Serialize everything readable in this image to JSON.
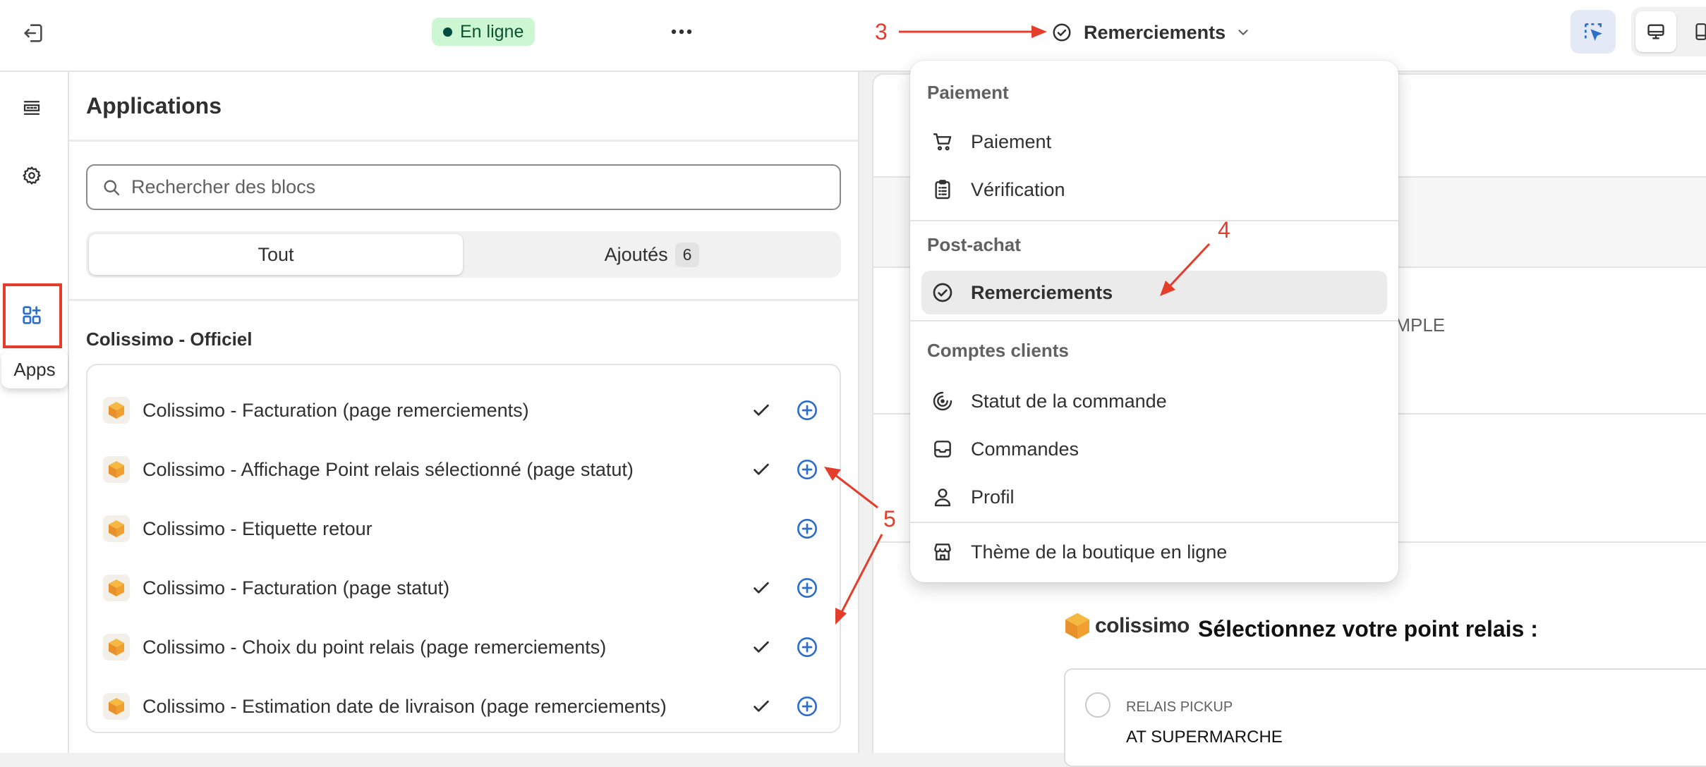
{
  "topbar": {
    "status": "En ligne",
    "page_selector": "Remerciements"
  },
  "rail": {
    "apps_tooltip": "Apps"
  },
  "apps_panel": {
    "title": "Applications",
    "search_placeholder": "Rechercher des blocs",
    "tabs": {
      "all": "Tout",
      "added": "Ajoutés",
      "added_count": "6"
    },
    "group_title": "Colissimo - Officiel",
    "blocks": [
      {
        "name": "Colissimo - Facturation (page remerciements)",
        "added": true
      },
      {
        "name": "Colissimo - Affichage Point relais sélectionné (page statut)",
        "added": true
      },
      {
        "name": "Colissimo - Etiquette retour",
        "added": false
      },
      {
        "name": "Colissimo - Facturation (page statut)",
        "added": true
      },
      {
        "name": "Colissimo - Choix du point relais (page remerciements)",
        "added": true
      },
      {
        "name": "Colissimo - Estimation date de livraison (page remerciements)",
        "added": true
      }
    ]
  },
  "dropdown": {
    "sections": [
      {
        "header": "Paiement",
        "items": [
          {
            "label": "Paiement",
            "icon": "cart-icon"
          },
          {
            "label": "Vérification",
            "icon": "clipboard-icon"
          }
        ]
      },
      {
        "header": "Post-achat",
        "items": [
          {
            "label": "Remerciements",
            "icon": "check-circle-icon",
            "selected": true
          }
        ]
      },
      {
        "header": "Comptes clients",
        "items": [
          {
            "label": "Statut de la commande",
            "icon": "order-status-icon"
          },
          {
            "label": "Commandes",
            "icon": "inbox-icon"
          },
          {
            "label": "Profil",
            "icon": "person-icon"
          }
        ]
      }
    ],
    "footer_item": "Thème de la boutique en ligne"
  },
  "preview": {
    "fragment_text": "AMPLE",
    "brand": "colissimo",
    "heading": "Sélectionnez votre point relais :",
    "relay_type": "RELAIS PICKUP",
    "relay_name": "AT SUPERMARCHE"
  },
  "annotations": {
    "n3": "3",
    "n4": "4",
    "n5": "5"
  },
  "colors": {
    "accent_blue": "#2c6ecb",
    "annotation_red": "#e43d2b",
    "status_green_bg": "#cdf7d3",
    "colissimo_orange": "#f0a030"
  }
}
